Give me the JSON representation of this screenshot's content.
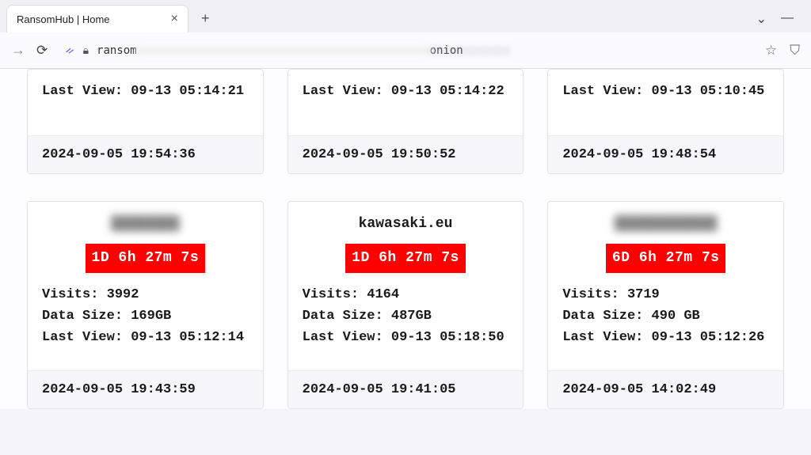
{
  "browser": {
    "tab_title": "RansomHub | Home",
    "url_prefix": "ransom",
    "url_suffix": "onion"
  },
  "row1": [
    {
      "last_view": "Last View: 09-13 05:14:21",
      "footer_ts": "2024-09-05 19:54:36"
    },
    {
      "last_view": "Last View: 09-13 05:14:22",
      "footer_ts": "2024-09-05 19:50:52"
    },
    {
      "last_view": "Last View: 09-13 05:10:45",
      "footer_ts": "2024-09-05 19:48:54"
    }
  ],
  "row2": [
    {
      "title": "████████",
      "title_blurred": true,
      "countdown": "1D 6h 27m 7s",
      "visits": "Visits: 3992",
      "data_size": "Data Size: 169GB",
      "last_view": "Last View: 09-13 05:12:14",
      "footer_ts": "2024-09-05 19:43:59"
    },
    {
      "title": "kawasaki.eu",
      "title_blurred": false,
      "countdown": "1D 6h 27m 7s",
      "visits": "Visits: 4164",
      "data_size": "Data Size: 487GB",
      "last_view": "Last View: 09-13 05:18:50",
      "footer_ts": "2024-09-05 19:41:05"
    },
    {
      "title": "████████████",
      "title_blurred": true,
      "countdown": "6D 6h 27m 7s",
      "visits": "Visits: 3719",
      "data_size": "Data Size: 490 GB",
      "last_view": "Last View: 09-13 05:12:26",
      "footer_ts": "2024-09-05 14:02:49"
    }
  ]
}
